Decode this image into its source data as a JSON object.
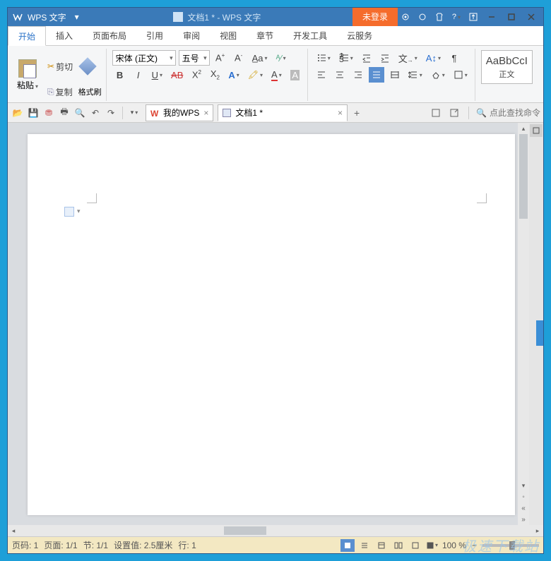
{
  "app": {
    "name": "WPS 文字",
    "doc_title": "文档1 * - WPS 文字",
    "login_button": "未登录"
  },
  "menu": {
    "tabs": [
      "开始",
      "插入",
      "页面布局",
      "引用",
      "审阅",
      "视图",
      "章节",
      "开发工具",
      "云服务"
    ],
    "active_index": 0
  },
  "ribbon": {
    "clipboard": {
      "cut": "剪切",
      "copy": "复制",
      "paste": "粘贴",
      "format_painter": "格式刷"
    },
    "font": {
      "family": "宋体 (正文)",
      "size": "五号"
    },
    "style_sample": {
      "sample": "AaBbCcI",
      "label": "正文"
    }
  },
  "doc_tabs": {
    "tabs": [
      {
        "label": "我的WPS",
        "closeable": true,
        "icon": "wps"
      },
      {
        "label": "文档1 *",
        "closeable": true,
        "icon": "doc",
        "active": true
      }
    ],
    "new_tab": "+"
  },
  "search": {
    "placeholder": "点此查找命令"
  },
  "status": {
    "page_code": "页码: 1",
    "page": "页面: 1/1",
    "section": "节: 1/1",
    "setting": "设置值: 2.5厘米",
    "line": "行: 1",
    "zoom": "100 %"
  },
  "watermark": "极速下载站"
}
